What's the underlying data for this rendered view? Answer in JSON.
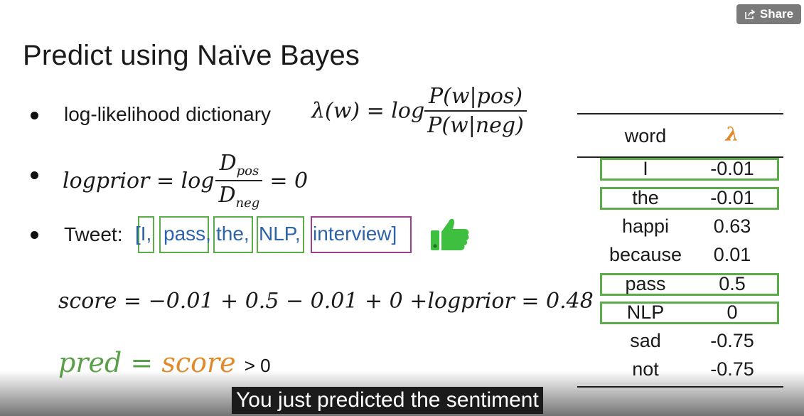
{
  "share_label": "Share",
  "title": "Predict using Naïve Bayes",
  "bullet1": {
    "text": "log-likelihood dictionary",
    "lhs": "λ(w) = log",
    "num": "P(w|pos)",
    "den": "P(w|neg)"
  },
  "bullet2": {
    "lhs": "logprior = log",
    "num": "D",
    "num_sub": "pos",
    "den": "D",
    "den_sub": "neg",
    "rhs": "= 0"
  },
  "bullet3": {
    "label": "Tweet:",
    "tokens": [
      "[I,",
      "pass,",
      "the,",
      "NLP,",
      "interview]"
    ]
  },
  "score_formula": "score = −0.01 + 0.5 − 0.01 + 0 +logprior = 0.48",
  "pred": {
    "lhs": "pred",
    "eq": "=",
    "score": "score",
    "gt": "> 0"
  },
  "table": {
    "headers": [
      "word",
      "λ"
    ],
    "header_lambda_color": "#e08a2b",
    "rows": [
      {
        "word": "I",
        "value": "-0.01",
        "highlighted": true
      },
      {
        "word": "the",
        "value": "-0.01",
        "highlighted": true
      },
      {
        "word": "happi",
        "value": "0.63",
        "highlighted": false
      },
      {
        "word": "because",
        "value": "0.01",
        "highlighted": false
      },
      {
        "word": "pass",
        "value": "0.5",
        "highlighted": true
      },
      {
        "word": "NLP",
        "value": "0",
        "highlighted": true
      },
      {
        "word": "sad",
        "value": "-0.75",
        "highlighted": false
      },
      {
        "word": "not",
        "value": "-0.75",
        "highlighted": false
      }
    ]
  },
  "caption": "You just predicted the sentiment",
  "colors": {
    "highlight_green": "#5aad48",
    "token_blue": "#2d63a8",
    "out_of_vocab_purple": "#9b3f8f",
    "thumb_green": "#3fbf3f"
  },
  "icons": [
    "share-icon",
    "thumbs-up-icon"
  ]
}
